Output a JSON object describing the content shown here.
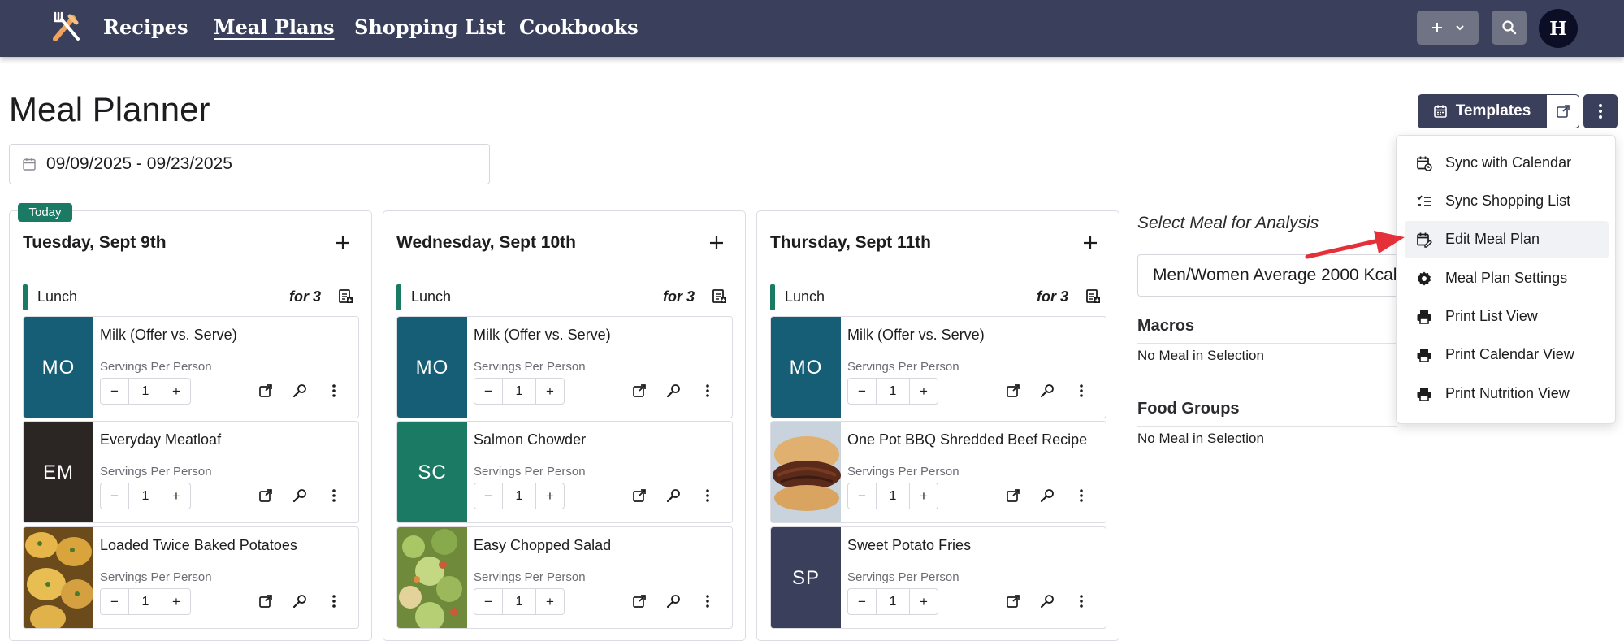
{
  "nav": {
    "links": [
      "Recipes",
      "Meal Plans",
      "Shopping List",
      "Cookbooks"
    ],
    "avatar_letter": "H"
  },
  "header": {
    "title": "Meal Planner",
    "date_range": "09/09/2025 - 09/23/2025",
    "templates_label": "Templates"
  },
  "today_label": "Today",
  "days": [
    {
      "title": "Tuesday, Sept 9th",
      "meal": "Lunch",
      "for_label": "for 3",
      "recipes": [
        {
          "name": "Milk (Offer vs. Serve)",
          "initials": "MO",
          "color": "#155e75",
          "servings_label": "Servings Per Person",
          "qty": "1"
        },
        {
          "name": "Everyday Meatloaf",
          "initials": "EM",
          "color": "#2b2523",
          "servings_label": "Servings Per Person",
          "qty": "1"
        },
        {
          "name": "Loaded Twice Baked Potatoes",
          "initials": "",
          "photo": "potatoes",
          "servings_label": "Servings Per Person",
          "qty": "1"
        }
      ]
    },
    {
      "title": "Wednesday, Sept 10th",
      "meal": "Lunch",
      "for_label": "for 3",
      "recipes": [
        {
          "name": "Milk (Offer vs. Serve)",
          "initials": "MO",
          "color": "#155e75",
          "servings_label": "Servings Per Person",
          "qty": "1"
        },
        {
          "name": "Salmon Chowder",
          "initials": "SC",
          "color": "#1a7a63",
          "servings_label": "Servings Per Person",
          "qty": "1"
        },
        {
          "name": "Easy Chopped Salad",
          "initials": "",
          "photo": "salad",
          "servings_label": "Servings Per Person",
          "qty": "1"
        }
      ]
    },
    {
      "title": "Thursday, Sept 11th",
      "meal": "Lunch",
      "for_label": "for 3",
      "recipes": [
        {
          "name": "Milk (Offer vs. Serve)",
          "initials": "MO",
          "color": "#155e75",
          "servings_label": "Servings Per Person",
          "qty": "1"
        },
        {
          "name": "One Pot BBQ Shredded Beef Recipe",
          "initials": "",
          "photo": "beef",
          "servings_label": "Servings Per Person",
          "qty": "1"
        },
        {
          "name": "Sweet Potato Fries",
          "initials": "SP",
          "color": "#3a3f5c",
          "servings_label": "Servings Per Person",
          "qty": "1"
        }
      ]
    }
  ],
  "analysis": {
    "title": "Select Meal for Analysis",
    "selected": "Men/Women Average 2000 Kcal",
    "macros_title": "Macros",
    "macros_text": "No Meal in Selection",
    "food_groups_title": "Food Groups",
    "food_groups_text": "No Meal in Selection"
  },
  "dropdown": {
    "items": [
      {
        "label": "Sync with Calendar",
        "icon": "calendar-sync-icon"
      },
      {
        "label": "Sync Shopping List",
        "icon": "list-check-icon"
      },
      {
        "label": "Edit Meal Plan",
        "icon": "calendar-edit-icon"
      },
      {
        "label": "Meal Plan Settings",
        "icon": "gear-icon"
      },
      {
        "label": "Print List View",
        "icon": "printer-icon"
      },
      {
        "label": "Print Calendar View",
        "icon": "printer-icon"
      },
      {
        "label": "Print Nutrition View",
        "icon": "printer-icon"
      }
    ]
  },
  "colors": {
    "navbar": "#3a3f5c",
    "accent_green": "#1a7a63",
    "arrow_red": "#e5303a"
  }
}
